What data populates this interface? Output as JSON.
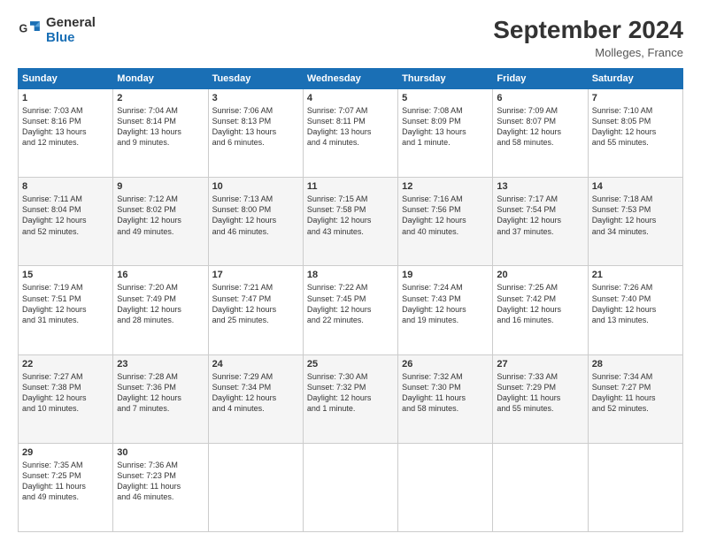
{
  "header": {
    "logo_general": "General",
    "logo_blue": "Blue",
    "title": "September 2024",
    "location": "Molleges, France"
  },
  "calendar": {
    "days_of_week": [
      "Sunday",
      "Monday",
      "Tuesday",
      "Wednesday",
      "Thursday",
      "Friday",
      "Saturday"
    ],
    "weeks": [
      [
        {
          "day": "1",
          "info": "Sunrise: 7:03 AM\nSunset: 8:16 PM\nDaylight: 13 hours\nand 12 minutes."
        },
        {
          "day": "2",
          "info": "Sunrise: 7:04 AM\nSunset: 8:14 PM\nDaylight: 13 hours\nand 9 minutes."
        },
        {
          "day": "3",
          "info": "Sunrise: 7:06 AM\nSunset: 8:13 PM\nDaylight: 13 hours\nand 6 minutes."
        },
        {
          "day": "4",
          "info": "Sunrise: 7:07 AM\nSunset: 8:11 PM\nDaylight: 13 hours\nand 4 minutes."
        },
        {
          "day": "5",
          "info": "Sunrise: 7:08 AM\nSunset: 8:09 PM\nDaylight: 13 hours\nand 1 minute."
        },
        {
          "day": "6",
          "info": "Sunrise: 7:09 AM\nSunset: 8:07 PM\nDaylight: 12 hours\nand 58 minutes."
        },
        {
          "day": "7",
          "info": "Sunrise: 7:10 AM\nSunset: 8:05 PM\nDaylight: 12 hours\nand 55 minutes."
        }
      ],
      [
        {
          "day": "8",
          "info": "Sunrise: 7:11 AM\nSunset: 8:04 PM\nDaylight: 12 hours\nand 52 minutes."
        },
        {
          "day": "9",
          "info": "Sunrise: 7:12 AM\nSunset: 8:02 PM\nDaylight: 12 hours\nand 49 minutes."
        },
        {
          "day": "10",
          "info": "Sunrise: 7:13 AM\nSunset: 8:00 PM\nDaylight: 12 hours\nand 46 minutes."
        },
        {
          "day": "11",
          "info": "Sunrise: 7:15 AM\nSunset: 7:58 PM\nDaylight: 12 hours\nand 43 minutes."
        },
        {
          "day": "12",
          "info": "Sunrise: 7:16 AM\nSunset: 7:56 PM\nDaylight: 12 hours\nand 40 minutes."
        },
        {
          "day": "13",
          "info": "Sunrise: 7:17 AM\nSunset: 7:54 PM\nDaylight: 12 hours\nand 37 minutes."
        },
        {
          "day": "14",
          "info": "Sunrise: 7:18 AM\nSunset: 7:53 PM\nDaylight: 12 hours\nand 34 minutes."
        }
      ],
      [
        {
          "day": "15",
          "info": "Sunrise: 7:19 AM\nSunset: 7:51 PM\nDaylight: 12 hours\nand 31 minutes."
        },
        {
          "day": "16",
          "info": "Sunrise: 7:20 AM\nSunset: 7:49 PM\nDaylight: 12 hours\nand 28 minutes."
        },
        {
          "day": "17",
          "info": "Sunrise: 7:21 AM\nSunset: 7:47 PM\nDaylight: 12 hours\nand 25 minutes."
        },
        {
          "day": "18",
          "info": "Sunrise: 7:22 AM\nSunset: 7:45 PM\nDaylight: 12 hours\nand 22 minutes."
        },
        {
          "day": "19",
          "info": "Sunrise: 7:24 AM\nSunset: 7:43 PM\nDaylight: 12 hours\nand 19 minutes."
        },
        {
          "day": "20",
          "info": "Sunrise: 7:25 AM\nSunset: 7:42 PM\nDaylight: 12 hours\nand 16 minutes."
        },
        {
          "day": "21",
          "info": "Sunrise: 7:26 AM\nSunset: 7:40 PM\nDaylight: 12 hours\nand 13 minutes."
        }
      ],
      [
        {
          "day": "22",
          "info": "Sunrise: 7:27 AM\nSunset: 7:38 PM\nDaylight: 12 hours\nand 10 minutes."
        },
        {
          "day": "23",
          "info": "Sunrise: 7:28 AM\nSunset: 7:36 PM\nDaylight: 12 hours\nand 7 minutes."
        },
        {
          "day": "24",
          "info": "Sunrise: 7:29 AM\nSunset: 7:34 PM\nDaylight: 12 hours\nand 4 minutes."
        },
        {
          "day": "25",
          "info": "Sunrise: 7:30 AM\nSunset: 7:32 PM\nDaylight: 12 hours\nand 1 minute."
        },
        {
          "day": "26",
          "info": "Sunrise: 7:32 AM\nSunset: 7:30 PM\nDaylight: 11 hours\nand 58 minutes."
        },
        {
          "day": "27",
          "info": "Sunrise: 7:33 AM\nSunset: 7:29 PM\nDaylight: 11 hours\nand 55 minutes."
        },
        {
          "day": "28",
          "info": "Sunrise: 7:34 AM\nSunset: 7:27 PM\nDaylight: 11 hours\nand 52 minutes."
        }
      ],
      [
        {
          "day": "29",
          "info": "Sunrise: 7:35 AM\nSunset: 7:25 PM\nDaylight: 11 hours\nand 49 minutes."
        },
        {
          "day": "30",
          "info": "Sunrise: 7:36 AM\nSunset: 7:23 PM\nDaylight: 11 hours\nand 46 minutes."
        },
        {
          "day": "",
          "info": ""
        },
        {
          "day": "",
          "info": ""
        },
        {
          "day": "",
          "info": ""
        },
        {
          "day": "",
          "info": ""
        },
        {
          "day": "",
          "info": ""
        }
      ]
    ]
  }
}
